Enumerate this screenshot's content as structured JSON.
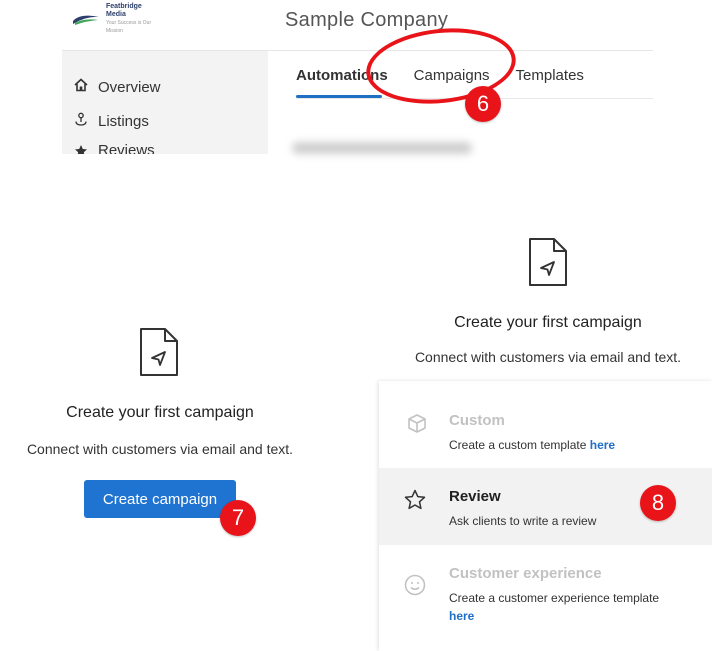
{
  "brand": {
    "name": "Featbridge Media",
    "tagline": "Your Success is Our Mission"
  },
  "header": {
    "company": "Sample Company"
  },
  "sidebar": {
    "items": [
      {
        "label": "Overview",
        "icon": "home-icon"
      },
      {
        "label": "Listings",
        "icon": "pin-icon"
      },
      {
        "label": "Reviews",
        "icon": "star-icon"
      }
    ]
  },
  "tabs": [
    {
      "label": "Automations",
      "active": true
    },
    {
      "label": "Campaigns",
      "active": false
    },
    {
      "label": "Templates",
      "active": false
    }
  ],
  "annotations": {
    "step6": "6",
    "step7": "7",
    "step8": "8",
    "color": "#e8141a"
  },
  "empty_state_left": {
    "title": "Create your first campaign",
    "subtitle": "Connect with customers via email and text.",
    "button": "Create campaign"
  },
  "empty_state_right": {
    "title": "Create your first campaign",
    "subtitle": "Connect with customers via email and text."
  },
  "templates": [
    {
      "name": "Custom",
      "desc": "Create a custom template ",
      "link": "here",
      "icon": "cube-icon",
      "disabled": true
    },
    {
      "name": "Review",
      "desc": "Ask clients to write a review",
      "icon": "star-outline-icon",
      "disabled": false,
      "hovered": true
    },
    {
      "name": "Customer experience",
      "desc": "Create a customer experience template",
      "link": "here",
      "icon": "smile-icon",
      "disabled": true
    }
  ],
  "colors": {
    "accent": "#1f73d1",
    "tab_underline": "#1f6fc5",
    "annotation": "#e8141a"
  }
}
